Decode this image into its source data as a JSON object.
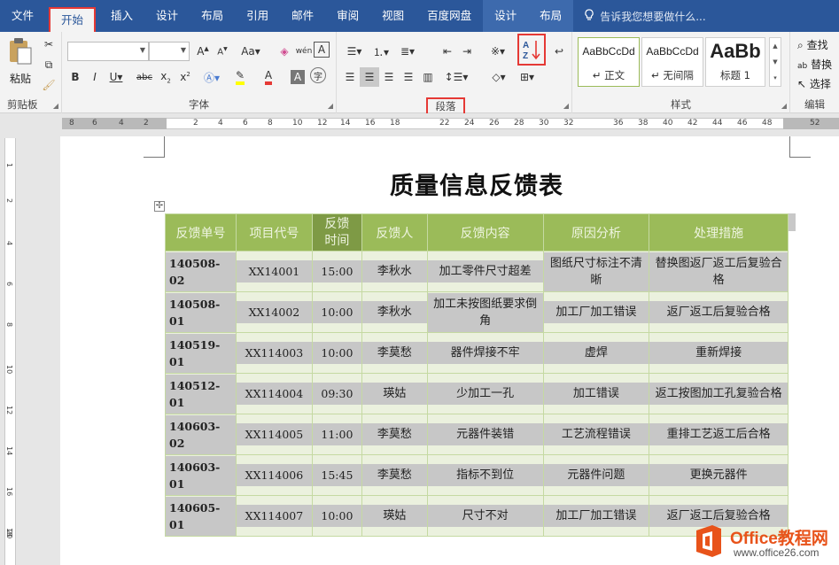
{
  "menu": {
    "tabs": [
      "文件",
      "开始",
      "插入",
      "设计",
      "布局",
      "引用",
      "邮件",
      "审阅",
      "视图",
      "百度网盘"
    ],
    "context_tabs": [
      "设计",
      "布局"
    ],
    "active": "开始",
    "tell_me": "告诉我您想要做什么..."
  },
  "ribbon": {
    "clipboard": {
      "paste": "粘贴",
      "label": "剪贴板"
    },
    "font": {
      "label": "字体",
      "font_name": "",
      "font_size": ""
    },
    "paragraph": {
      "label": "段落"
    },
    "styles": {
      "label": "样式",
      "items": [
        {
          "sample": "AaBbCcDd",
          "name": "↵ 正文"
        },
        {
          "sample": "AaBbCcDd",
          "name": "↵ 无间隔"
        },
        {
          "sample": "AaBb",
          "name": "标题 1"
        }
      ]
    },
    "editing": {
      "label": "编辑",
      "find": "查找",
      "replace": "替换",
      "select": "选择"
    }
  },
  "ruler": {
    "h_numbers": [
      "8",
      "6",
      "4",
      "2",
      "2",
      "4",
      "6",
      "8",
      "10",
      "12",
      "14",
      "16",
      "18",
      "22",
      "24",
      "26",
      "28",
      "30",
      "32",
      "36",
      "38",
      "40",
      "42",
      "44",
      "46",
      "48",
      "52"
    ],
    "v_numbers": [
      "1",
      "2",
      "4",
      "6",
      "8",
      "10",
      "12",
      "14",
      "16",
      "18",
      "20"
    ]
  },
  "document": {
    "title": "质量信息反馈表",
    "table": {
      "headers": [
        "反馈单号",
        "项目代号",
        "反馈时间",
        "反馈人",
        "反馈内容",
        "原因分析",
        "处理措施"
      ],
      "rows": [
        [
          "140508-02",
          "XX14001",
          "15:00",
          "李秋水",
          "加工零件尺寸超差",
          "图纸尺寸标注不清晰",
          "替换图返厂返工后复验合格"
        ],
        [
          "140508-01",
          "XX14002",
          "10:00",
          "李秋水",
          "加工未按图纸要求倒角",
          "加工厂加工错误",
          "返厂返工后复验合格"
        ],
        [
          "140519-01",
          "XX114003",
          "10:00",
          "李莫愁",
          "器件焊接不牢",
          "虚焊",
          "重新焊接"
        ],
        [
          "140512-01",
          "XX114004",
          "09:30",
          "瑛姑",
          "少加工一孔",
          "加工错误",
          "返工按图加工孔复验合格"
        ],
        [
          "140603-02",
          "XX114005",
          "11:00",
          "李莫愁",
          "元器件装错",
          "工艺流程错误",
          "重排工艺返工后合格"
        ],
        [
          "140603-01",
          "XX114006",
          "15:45",
          "李莫愁",
          "指标不到位",
          "元器件问题",
          "更换元器件"
        ],
        [
          "140605-01",
          "XX114007",
          "10:00",
          "瑛姑",
          "尺寸不对",
          "加工厂加工错误",
          "返厂返工后复验合格"
        ]
      ]
    }
  },
  "watermark": {
    "brand": "Office教程网",
    "site": "www.office26.com"
  }
}
